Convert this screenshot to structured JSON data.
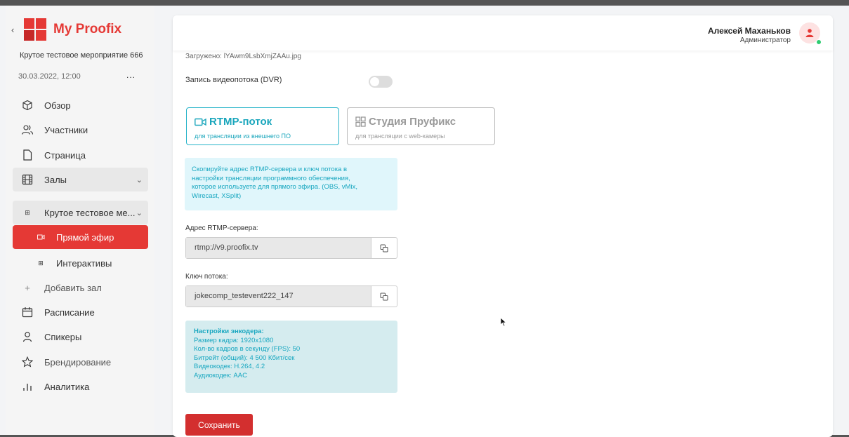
{
  "sidebar": {
    "back_icon": "chevron-left-icon",
    "brand": "My Proofix",
    "event_title": "Крутое тестовое мероприятие 666",
    "event_date": "30.03.2022, 12:00",
    "event_menu": "...",
    "items": [
      {
        "label": "Обзор",
        "icon": "cube-icon"
      },
      {
        "label": "Участники",
        "icon": "users-icon"
      },
      {
        "label": "Страница",
        "icon": "file-icon"
      },
      {
        "label": "Залы",
        "icon": "film-icon"
      },
      {
        "label": "Крутое тестовое ме...",
        "icon": "grid-icon"
      },
      {
        "label": "Прямой эфир",
        "icon": "video-icon"
      },
      {
        "label": "Интерактивы",
        "icon": "grid-icon"
      },
      {
        "label": "Добавить зал",
        "icon": "plus-icon"
      },
      {
        "label": "Расписание",
        "icon": "calendar-icon"
      },
      {
        "label": "Спикеры",
        "icon": "user-icon"
      },
      {
        "label": "Брендирование",
        "icon": "star-icon"
      },
      {
        "label": "Аналитика",
        "icon": "bar-chart-icon"
      }
    ]
  },
  "header": {
    "user_name": "Алексей Маханьков",
    "user_role": "Администратор"
  },
  "main": {
    "uploaded": "Загружено: lYAwm9LsbXmjZAAu.jpg",
    "dvr_label": "Запись видеопотока (DVR)",
    "dvr_enabled": false,
    "cards": {
      "rtmp": {
        "title": "RTMP-поток",
        "subtitle": "для трансляции из внешнего ПО"
      },
      "studio": {
        "title": "Студия Пруфикс",
        "subtitle": "для трансляции с web-камеры"
      }
    },
    "hint_lines": [
      "Скопируйте адрес RTMP-сервера и ключ потока в",
      "настройки трансляции программного обеспечения,",
      "которое используете для прямого эфира. (OBS, vMix,",
      "Wirecast, XSplit)"
    ],
    "rtmp_label": "Адрес RTMP-сервера:",
    "rtmp_value": "rtmp://v9.proofix.tv",
    "key_label": "Ключ потока:",
    "key_value": "jokecomp_testevent222_147",
    "encoder": {
      "title": "Настройки энкодера:",
      "lines": [
        "Размер кадра: 1920x1080",
        "Кол-во кадров в секунду (FPS): 50",
        "Битрейт (общий): 4 500 Кбит/сек",
        "Видеокодек: H.264, 4.2",
        "Аудиокодек: AAC"
      ]
    },
    "save_label": "Сохранить"
  },
  "colors": {
    "brand_red": "#e53935",
    "accent_cyan": "#1aa6bc",
    "online_green": "#2ecc71"
  }
}
